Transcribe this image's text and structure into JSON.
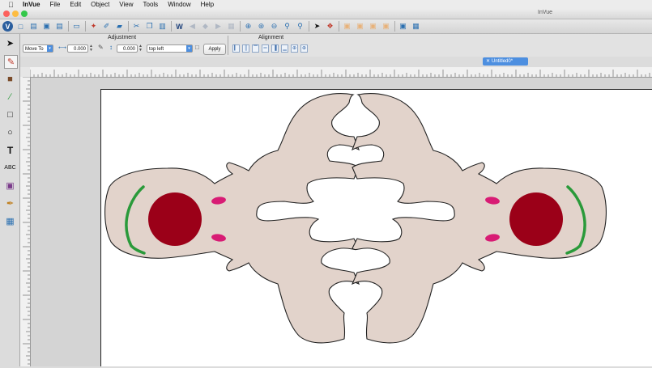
{
  "menubar": {
    "app_name": "InVue",
    "items": [
      "File",
      "Edit",
      "Object",
      "View",
      "Tools",
      "Window",
      "Help"
    ]
  },
  "window": {
    "title": "InVue"
  },
  "properties": {
    "adjustment_title": "Adjustment",
    "alignment_title": "Alignment",
    "mode_value": "Move To",
    "x_value": "0.000",
    "y_value": "0.000",
    "anchor_value": "top left",
    "apply_label": "Apply"
  },
  "document": {
    "tab_label": "Untitled0*"
  },
  "colors": {
    "shape_fill": "#e2d3cb",
    "eye_red": "#9b0018",
    "cheek_pink": "#d81b74",
    "brow_green": "#2a9a3a",
    "tab_blue": "#4d8fe0"
  }
}
